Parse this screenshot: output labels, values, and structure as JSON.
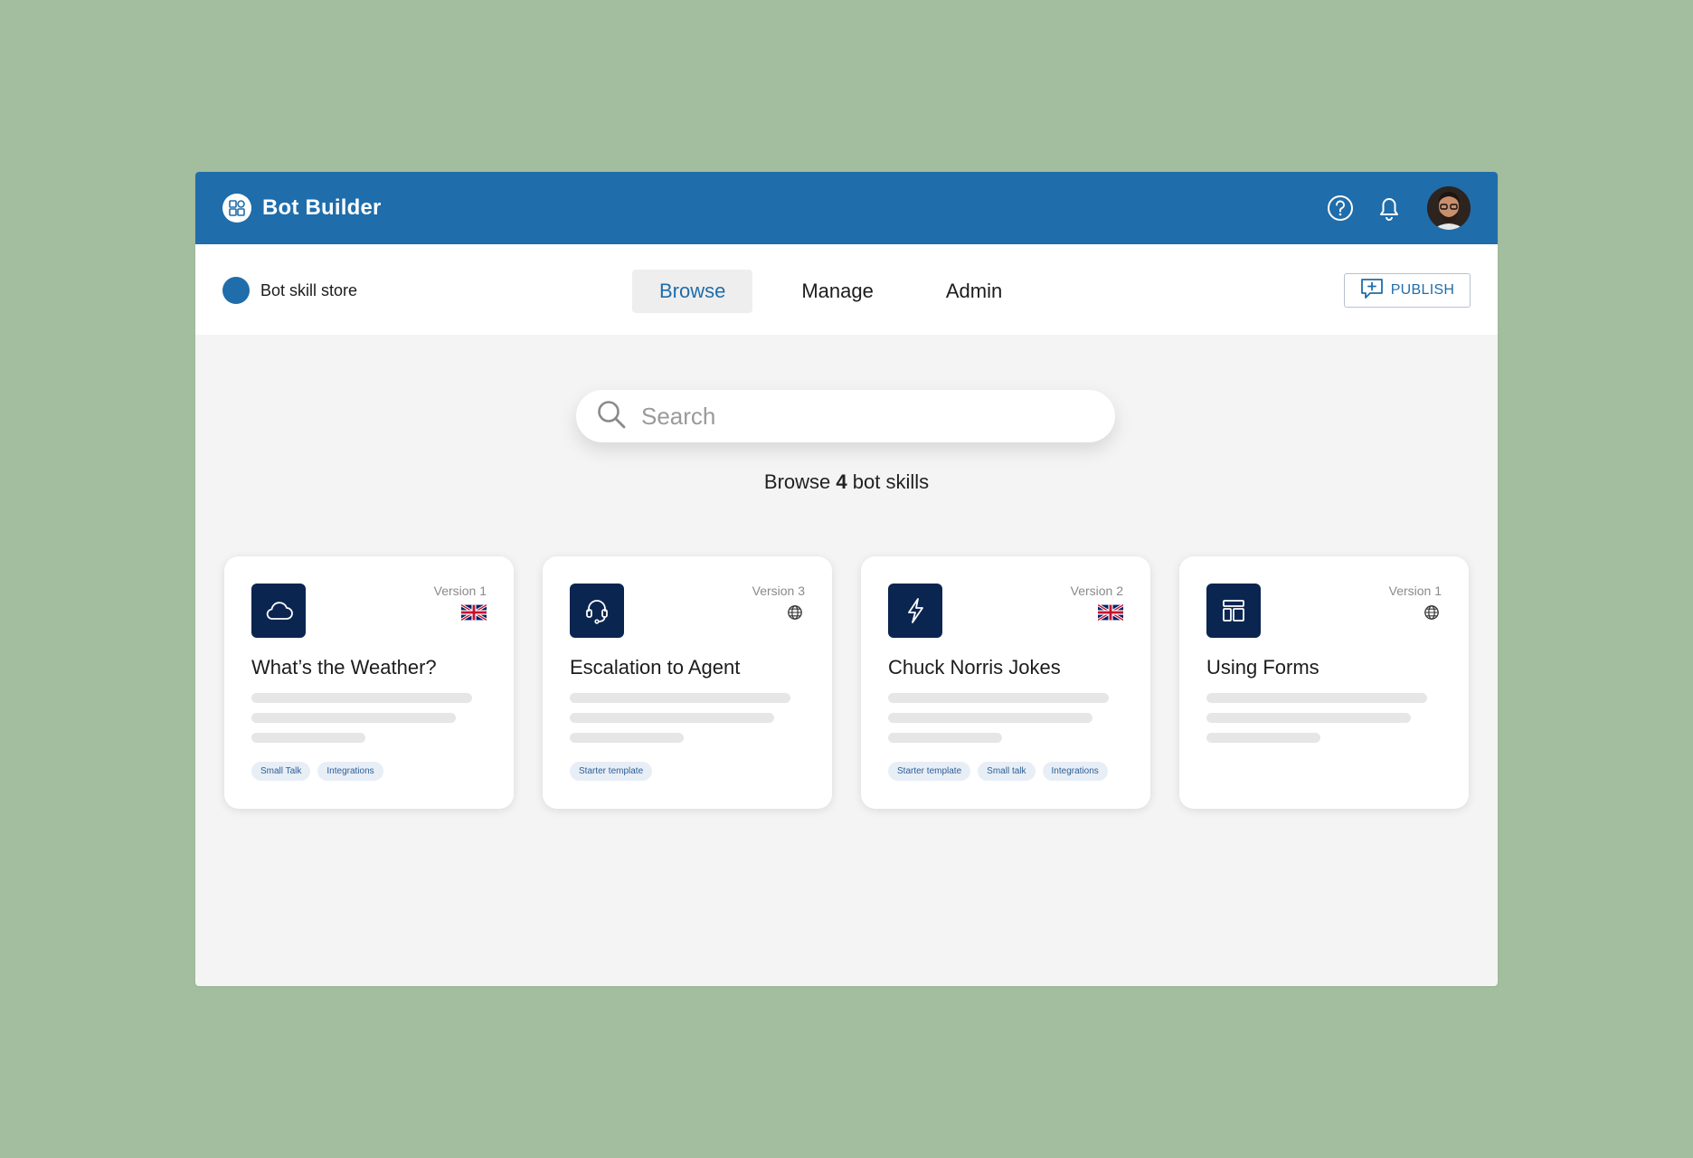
{
  "colors": {
    "background": "#a3bd9f",
    "brand": "#1f6dab",
    "card_icon_bg": "#0a2550",
    "canvas": "#f4f4f4"
  },
  "header": {
    "title": "Bot Builder",
    "logo_icon": "bot-builder-logo-icon",
    "help_icon": "help-icon",
    "notifications_icon": "bell-icon",
    "avatar": "user-avatar"
  },
  "subheader": {
    "store_label": "Bot skill store",
    "tabs": [
      {
        "label": "Browse",
        "active": true
      },
      {
        "label": "Manage",
        "active": false
      },
      {
        "label": "Admin",
        "active": false
      }
    ],
    "publish_label": "PUBLISH",
    "publish_icon": "add-comment-icon"
  },
  "search": {
    "placeholder": "Search",
    "value": ""
  },
  "summary": {
    "prefix": "Browse",
    "count": "4",
    "suffix": "bot skills"
  },
  "cards": [
    {
      "title": "What’s the Weather?",
      "version": "Version 1",
      "icon": "cloud-icon",
      "language": "uk-flag-icon",
      "tags": [
        "Small Talk",
        "Integrations"
      ]
    },
    {
      "title": "Escalation to Agent",
      "version": "Version 3",
      "icon": "headset-icon",
      "language": "globe-icon",
      "tags": [
        "Starter template"
      ]
    },
    {
      "title": "Chuck Norris Jokes",
      "version": "Version 2",
      "icon": "lightning-icon",
      "language": "uk-flag-icon",
      "tags": [
        "Starter template",
        "Small talk",
        "Integrations"
      ]
    },
    {
      "title": "Using Forms",
      "version": "Version 1",
      "icon": "layout-icon",
      "language": "globe-icon",
      "tags": []
    }
  ]
}
